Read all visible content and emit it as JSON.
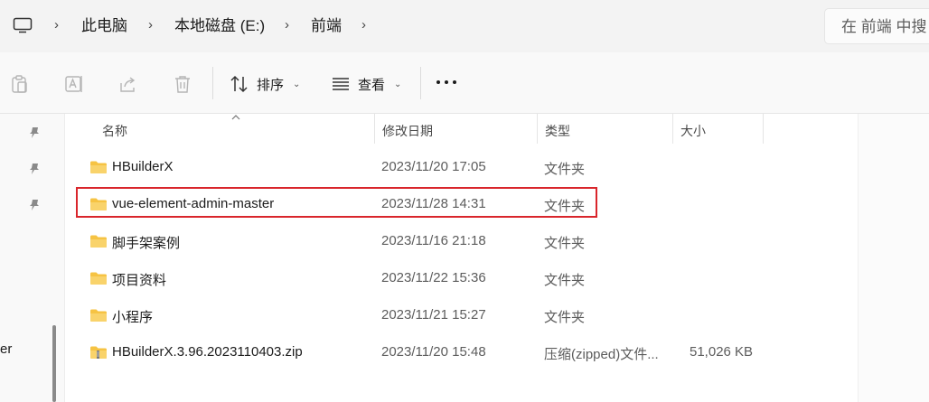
{
  "address": {
    "crumbs": [
      "此电脑",
      "本地磁盘 (E:)",
      "前端"
    ],
    "search_placeholder": "在 前端 中搜"
  },
  "commands": {
    "sort_label": "排序",
    "view_label": "查看"
  },
  "nav": {
    "partial_text": "er"
  },
  "columns": [
    "名称",
    "修改日期",
    "类型",
    "大小"
  ],
  "files": [
    {
      "name": "HBuilderX",
      "date": "2023/11/20 17:05",
      "type": "文件夹",
      "size": "",
      "icon": "folder-icon"
    },
    {
      "name": "vue-element-admin-master",
      "date": "2023/11/28 14:31",
      "type": "文件夹",
      "size": "",
      "icon": "folder-icon"
    },
    {
      "name": "脚手架案例",
      "date": "2023/11/16 21:18",
      "type": "文件夹",
      "size": "",
      "icon": "folder-icon"
    },
    {
      "name": "项目资料",
      "date": "2023/11/22 15:36",
      "type": "文件夹",
      "size": "",
      "icon": "folder-icon"
    },
    {
      "name": "小程序",
      "date": "2023/11/21 15:27",
      "type": "文件夹",
      "size": "",
      "icon": "folder-icon"
    },
    {
      "name": "HBuilderX.3.96.2023110403.zip",
      "date": "2023/11/20 15:48",
      "type": "压缩(zipped)文件...",
      "size": "51,026 KB",
      "icon": "zip-folder-icon"
    }
  ],
  "colors": {
    "folder": "#f6c343",
    "highlight": "#d9262c"
  }
}
